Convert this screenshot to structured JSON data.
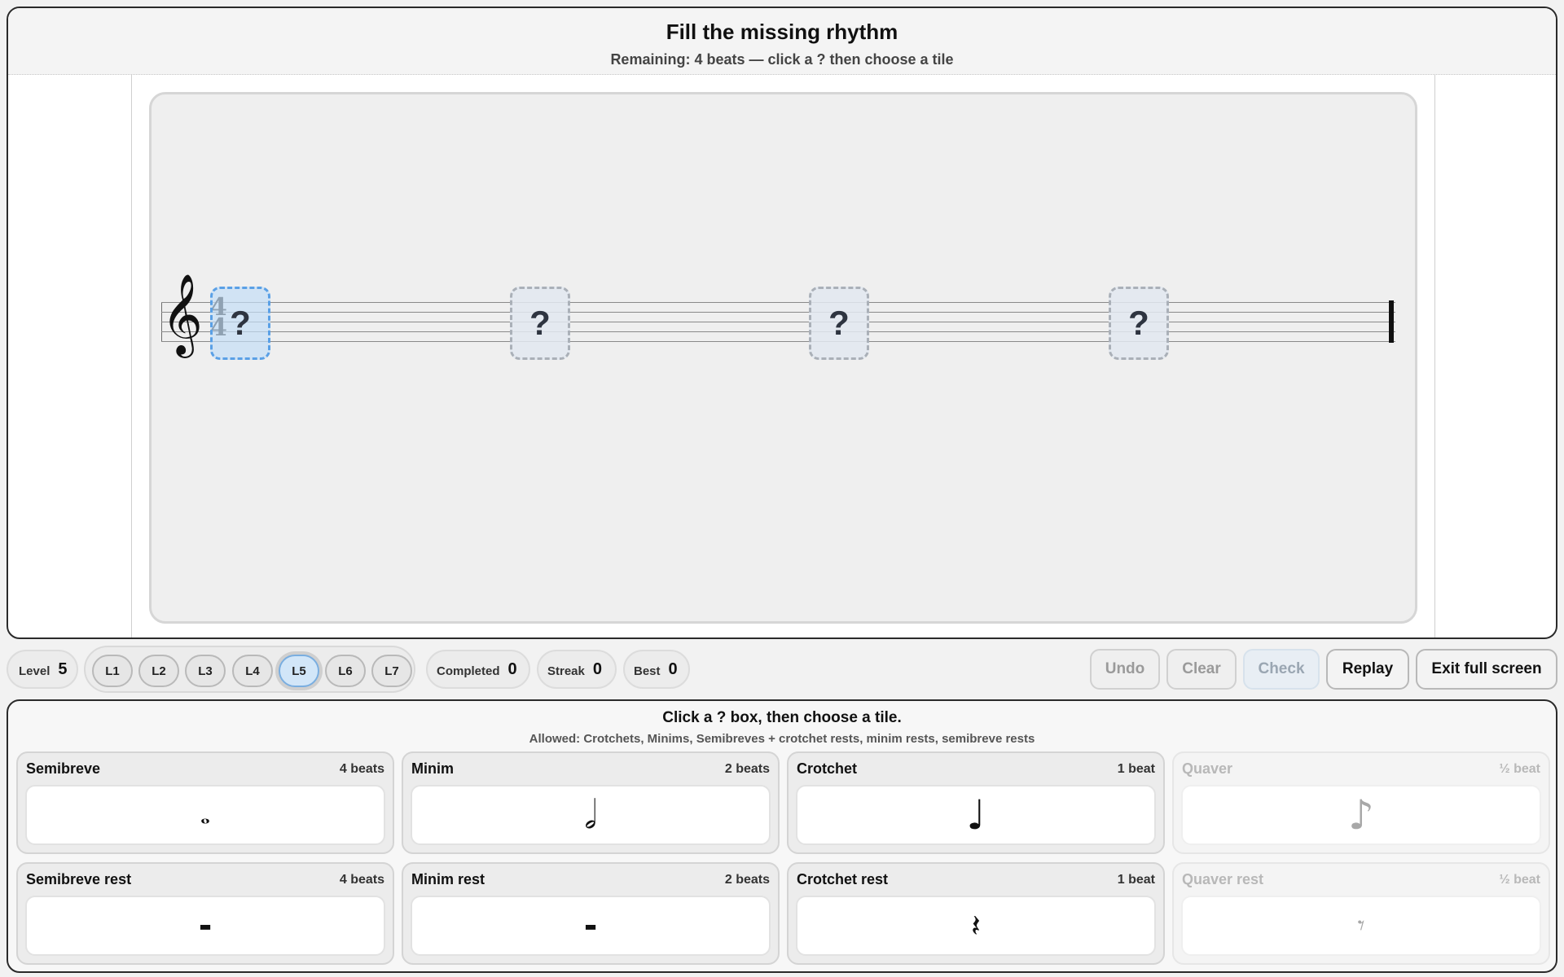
{
  "header": {
    "title": "Fill the missing rhythm",
    "subtitle": "Remaining: 4 beats — click a ? then choose a tile"
  },
  "staff": {
    "clef": "𝄞",
    "time_signature": {
      "top": "4",
      "bottom": "4"
    },
    "slot_symbol": "?",
    "slots": [
      {
        "label": "?",
        "active": true
      },
      {
        "label": "?",
        "active": false
      },
      {
        "label": "?",
        "active": false
      },
      {
        "label": "?",
        "active": false
      }
    ]
  },
  "controls": {
    "level": {
      "label": "Level",
      "value": "5"
    },
    "levels": [
      "L1",
      "L2",
      "L3",
      "L4",
      "L5",
      "L6",
      "L7"
    ],
    "active_level": "L5",
    "completed": {
      "label": "Completed",
      "value": "0"
    },
    "streak": {
      "label": "Streak",
      "value": "0"
    },
    "best": {
      "label": "Best",
      "value": "0"
    },
    "buttons": {
      "undo": "Undo",
      "clear": "Clear",
      "check": "Check",
      "replay": "Replay",
      "exit": "Exit full screen"
    }
  },
  "tiles_panel": {
    "title": "Click a ? box, then choose a tile.",
    "allowed": "Allowed: Crotchets, Minims, Semibreves + crotchet rests, minim rests, semibreve rests",
    "tiles": [
      {
        "name": "Semibreve",
        "beats": "4 beats",
        "glyph": "𝅝",
        "enabled": true
      },
      {
        "name": "Minim",
        "beats": "2 beats",
        "glyph": "𝅗𝅥",
        "enabled": true
      },
      {
        "name": "Crotchet",
        "beats": "1 beat",
        "glyph": "♩",
        "enabled": true
      },
      {
        "name": "Quaver",
        "beats": "½ beat",
        "glyph": "♪",
        "enabled": false
      },
      {
        "name": "Semibreve rest",
        "beats": "4 beats",
        "glyph": "▬",
        "enabled": true
      },
      {
        "name": "Minim rest",
        "beats": "2 beats",
        "glyph": "▬",
        "enabled": true
      },
      {
        "name": "Crotchet rest",
        "beats": "1 beat",
        "glyph": "𝄽",
        "enabled": true
      },
      {
        "name": "Quaver rest",
        "beats": "½ beat",
        "glyph": "𝄾",
        "enabled": false
      }
    ]
  },
  "colors": {
    "active_slot": "#5aa0e6",
    "panel_border": "#2a2a2a"
  }
}
